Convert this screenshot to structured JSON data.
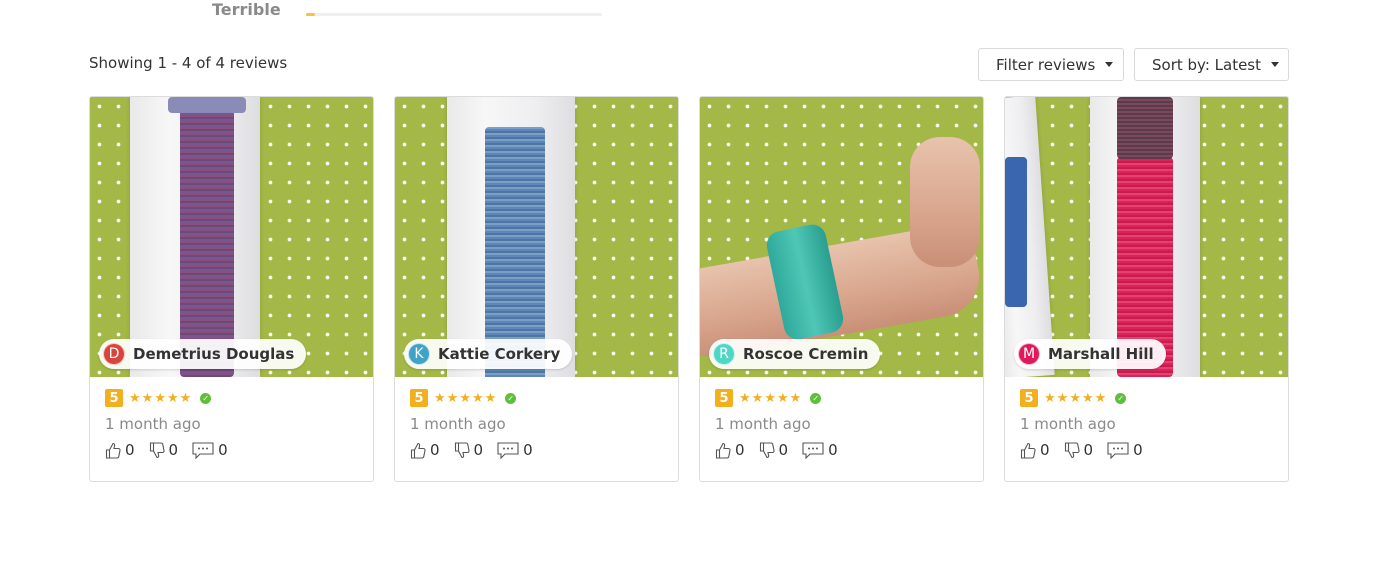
{
  "rating": {
    "label": "Terrible",
    "count": "0",
    "fraction": 0.03
  },
  "toolbar": {
    "showing": "Showing 1 - 4 of 4 reviews",
    "filter_label": "Filter reviews",
    "sort_label": "Sort by: Latest"
  },
  "colors": {
    "star": "#f2b01e",
    "verified": "#5fbf3a",
    "photo_bg": "#a3b846"
  },
  "reviews": [
    {
      "initial": "D",
      "avatar_color": "#d9453c",
      "name": "Demetrius Douglas",
      "score": "5",
      "stars": 5,
      "time": "1 month ago",
      "likes": "0",
      "dislikes": "0",
      "comments": "0"
    },
    {
      "initial": "K",
      "avatar_color": "#3fa3c7",
      "name": "Kattie Corkery",
      "score": "5",
      "stars": 5,
      "time": "1 month ago",
      "likes": "0",
      "dislikes": "0",
      "comments": "0"
    },
    {
      "initial": "R",
      "avatar_color": "#4fd6c5",
      "name": "Roscoe Cremin",
      "score": "5",
      "stars": 5,
      "time": "1 month ago",
      "likes": "0",
      "dislikes": "0",
      "comments": "0"
    },
    {
      "initial": "M",
      "avatar_color": "#e0195a",
      "name": "Marshall Hill",
      "score": "5",
      "stars": 5,
      "time": "1 month ago",
      "likes": "0",
      "dislikes": "0",
      "comments": "0"
    }
  ]
}
